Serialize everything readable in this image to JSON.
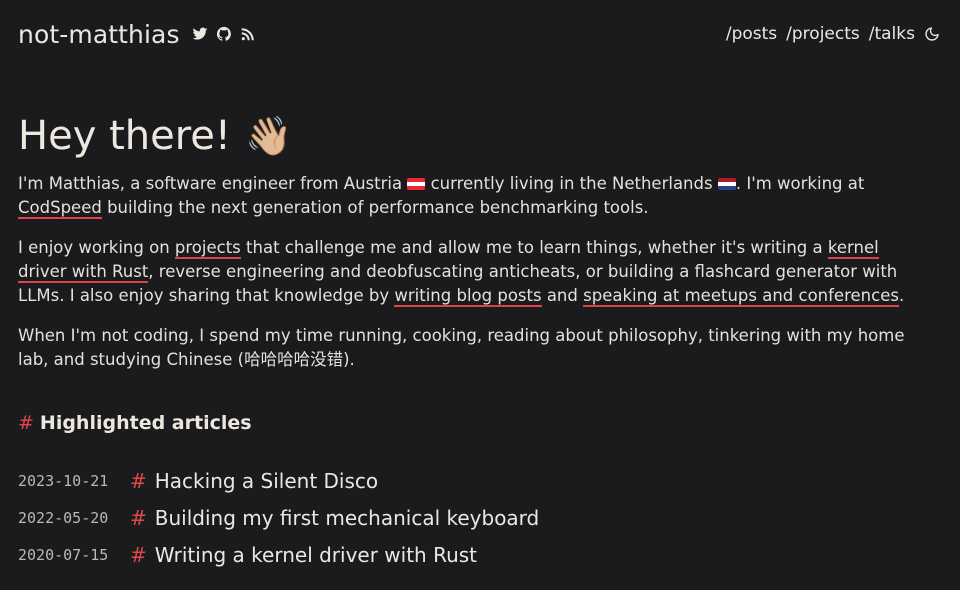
{
  "header": {
    "title": "not-matthias",
    "social": [
      {
        "icon": "twitter-icon"
      },
      {
        "icon": "github-icon"
      },
      {
        "icon": "rss-icon"
      }
    ],
    "nav": [
      "/posts",
      "/projects",
      "/talks"
    ],
    "theme_icon": "moon-icon"
  },
  "intro": {
    "heading": "Hey there!",
    "wave": "👋🏼",
    "p1": {
      "t1": "I'm Matthias, a software engineer from Austria ",
      "t2": " currently living in the Netherlands ",
      "t3": ". I'm working at ",
      "link_codspeed": "CodSpeed",
      "t4": " building the next generation of performance benchmarking tools."
    },
    "p2": {
      "t1": "I enjoy working on ",
      "link_projects": "projects",
      "t2": " that challenge me and allow me to learn things, whether it's writing a ",
      "link_kernel": "kernel driver with Rust",
      "t3": ", reverse engineering and deobfuscating anticheats, or building a flashcard generator with LLMs. I also enjoy sharing that knowledge by ",
      "link_blog": "writing blog posts",
      "t4": " and ",
      "link_talks": "speaking at meetups and conferences",
      "t5": "."
    },
    "p3": "When I'm not coding, I spend my time running, cooking, reading about philosophy, tinkering with my home lab, and studying Chinese (哈哈哈哈没错).",
    "flag_colors": {
      "austria": [
        "#ed2939",
        "#ffffff",
        "#ed2939"
      ],
      "netherlands": [
        "#ae1c28",
        "#ffffff",
        "#21468b"
      ]
    }
  },
  "highlighted": {
    "hash": "#",
    "title": "Highlighted articles",
    "articles": [
      {
        "date": "2023-10-21",
        "title": "Hacking a Silent Disco"
      },
      {
        "date": "2022-05-20",
        "title": "Building my first mechanical keyboard"
      },
      {
        "date": "2020-07-15",
        "title": "Writing a kernel driver with Rust"
      }
    ]
  },
  "colors": {
    "background": "#1b1b1e",
    "accent": "#e0474c",
    "text": "#ece8e0"
  }
}
